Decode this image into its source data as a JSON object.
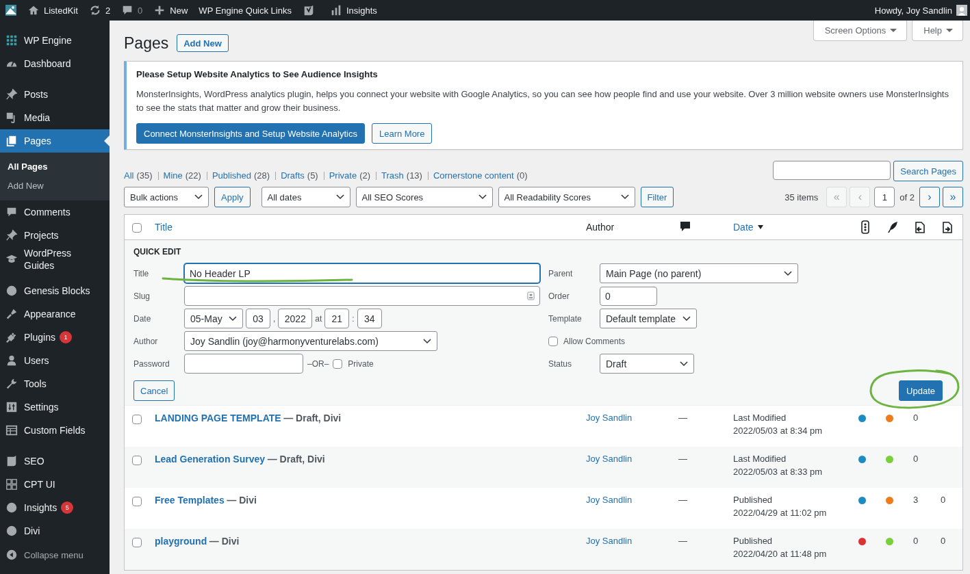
{
  "admin_bar": {
    "site": "ListedKit",
    "updates": "2",
    "comments": "0",
    "new": "New",
    "quick_links": "WP Engine Quick Links",
    "insights": "Insights",
    "greeting": "Howdy, Joy Sandlin"
  },
  "sidebar": {
    "groups": [
      [
        {
          "label": "WP Engine",
          "kind": "grid",
          "selected": false
        },
        {
          "label": "Dashboard",
          "kind": "gauge",
          "selected": false
        }
      ],
      [
        {
          "label": "Posts",
          "kind": "pin",
          "selected": false
        },
        {
          "label": "Media",
          "kind": "media",
          "selected": false
        },
        {
          "label": "Pages",
          "kind": "pages",
          "selected": true,
          "children": [
            {
              "label": "All Pages",
              "selected": true
            },
            {
              "label": "Add New",
              "selected": false
            }
          ]
        },
        {
          "label": "Comments",
          "kind": "bubble",
          "selected": false
        },
        {
          "label": "Projects",
          "kind": "pin",
          "selected": false
        },
        {
          "label": "WordPress Guides",
          "kind": "cap",
          "selected": false
        }
      ],
      [
        {
          "label": "Genesis Blocks",
          "kind": "circle",
          "selected": false
        },
        {
          "label": "Appearance",
          "kind": "brush",
          "selected": false
        },
        {
          "label": "Plugins",
          "kind": "plug",
          "selected": false,
          "badge": "1"
        },
        {
          "label": "Users",
          "kind": "user",
          "selected": false
        },
        {
          "label": "Tools",
          "kind": "wrench",
          "selected": false
        },
        {
          "label": "Settings",
          "kind": "sliders",
          "selected": false
        },
        {
          "label": "Custom Fields",
          "kind": "table",
          "selected": false
        }
      ],
      [
        {
          "label": "SEO",
          "kind": "shield",
          "selected": false
        },
        {
          "label": "CPT UI",
          "kind": "squares",
          "selected": false
        },
        {
          "label": "Insights",
          "kind": "circle",
          "selected": false,
          "badge": "5"
        },
        {
          "label": "Divi",
          "kind": "circle",
          "selected": false
        }
      ]
    ],
    "collapse": "Collapse menu"
  },
  "header": {
    "title": "Pages",
    "add_new": "Add New",
    "screen_options": "Screen Options",
    "help": "Help"
  },
  "notice": {
    "title": "Please Setup Website Analytics to See Audience Insights",
    "body": "MonsterInsights, WordPress analytics plugin, helps you connect your website with Google Analytics, so you can see how people find and use your website. Over 3 million website owners use MonsterInsights to see the stats that matter and grow their business.",
    "primary": "Connect MonsterInsights and Setup Website Analytics",
    "secondary": "Learn More"
  },
  "views": [
    {
      "label": "All",
      "count": "(35)",
      "selected": false
    },
    {
      "label": "Mine",
      "count": "(22)",
      "selected": false
    },
    {
      "label": "Published",
      "count": "(28)",
      "selected": false
    },
    {
      "label": "Drafts",
      "count": "(5)",
      "selected": false
    },
    {
      "label": "Private",
      "count": "(2)",
      "selected": false
    },
    {
      "label": "Trash",
      "count": "(13)",
      "selected": false
    },
    {
      "label": "Cornerstone content",
      "count": "(0)",
      "selected": false
    }
  ],
  "search": {
    "button": "Search Pages"
  },
  "tablenav": {
    "bulk": "Bulk actions",
    "apply": "Apply",
    "dates": "All dates",
    "seo": "All SEO Scores",
    "readability": "All Readability Scores",
    "filter": "Filter",
    "items": "35 items",
    "pages": [
      {
        "label": "«",
        "disabled": true
      },
      {
        "label": "‹",
        "disabled": true
      }
    ],
    "current": "1",
    "of": "of 2",
    "next": [
      {
        "label": "›",
        "disabled": false
      },
      {
        "label": "»",
        "disabled": false
      }
    ]
  },
  "table": {
    "select_all": {
      "checked": false
    },
    "columns": {
      "title": "Title",
      "author": "Author",
      "date": "Date"
    },
    "quick_edit": {
      "heading": "QUICK EDIT",
      "title": {
        "label": "Title",
        "value": "No Header LP"
      },
      "slug": {
        "label": "Slug"
      },
      "date": {
        "label": "Date",
        "month": "05-May",
        "day": "03",
        "sep1": ",",
        "year": "2022",
        "at": "at",
        "hour": "21",
        "sep2": ":",
        "minute": "34"
      },
      "author": {
        "label": "Author",
        "value": "Joy Sandlin (joy@harmonyventurelabs.com)"
      },
      "password": {
        "label": "Password",
        "or": "–OR–",
        "private_label": "Private",
        "private_checked": false
      },
      "parent": {
        "label": "Parent",
        "value": "Main Page (no parent)"
      },
      "order": {
        "label": "Order",
        "value": "0"
      },
      "template": {
        "label": "Template",
        "value": "Default template"
      },
      "allow_comments": {
        "label": "Allow Comments",
        "checked": false
      },
      "status": {
        "label": "Status",
        "value": "Draft"
      },
      "cancel": "Cancel",
      "update": "Update"
    },
    "rows": [
      {
        "checked": false,
        "title": "LANDING PAGE TEMPLATE",
        "state": "— Draft, Divi",
        "author": "Joy Sandlin",
        "comments": "—",
        "date_status": "Last Modified",
        "date": "2022/05/03 at 8:34 pm",
        "seo": {
          "color": "#1e8cbe"
        },
        "readability": {
          "color": "#ee7c1b"
        },
        "column_8": "0"
      },
      {
        "checked": false,
        "title": "Lead Generation Survey",
        "state": "— Draft, Divi",
        "author": "Joy Sandlin",
        "comments": "—",
        "date_status": "Last Modified",
        "date": "2022/05/03 at 8:33 pm",
        "seo": {
          "color": "#1e8cbe"
        },
        "readability": {
          "color": "#7ad03a"
        },
        "column_8": "0"
      },
      {
        "checked": false,
        "title": "Free Templates",
        "state": "— Divi",
        "author": "Joy Sandlin",
        "comments": "—",
        "date_status": "Published",
        "date": "2022/04/29 at 11:02 pm",
        "seo": {
          "color": "#1e8cbe"
        },
        "readability": {
          "color": "#ee7c1b"
        },
        "column_8": "3",
        "column_9": "0"
      },
      {
        "checked": false,
        "title": "playground",
        "state": "— Divi",
        "author": "Joy Sandlin",
        "comments": "—",
        "date_status": "Published",
        "date": "2022/04/20 at 11:48 pm",
        "seo": {
          "color": "#dc3232"
        },
        "readability": {
          "color": "#7ad03a"
        },
        "column_8": "0",
        "column_9": "0"
      }
    ]
  }
}
